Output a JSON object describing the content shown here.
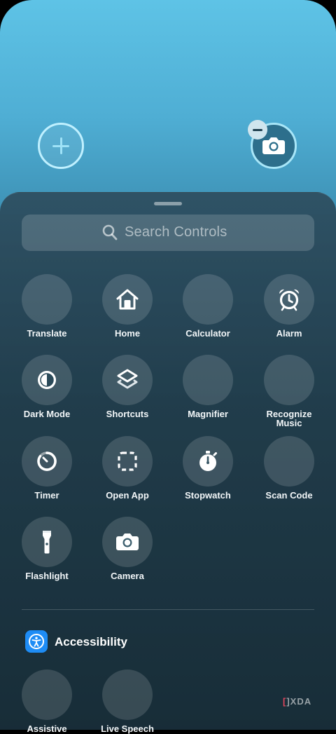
{
  "lock_screen": {
    "left_button_icon": "plus-icon",
    "right_button_icon": "camera-icon",
    "remove_badge_icon": "minus-icon"
  },
  "search": {
    "placeholder": "Search Controls",
    "icon": "magnifying-glass-icon"
  },
  "controls": [
    {
      "label": "Translate",
      "icon": "none"
    },
    {
      "label": "Home",
      "icon": "house-icon"
    },
    {
      "label": "Calculator",
      "icon": "none"
    },
    {
      "label": "Alarm",
      "icon": "alarm-clock-icon"
    },
    {
      "label": "Dark Mode",
      "icon": "half-circle-icon"
    },
    {
      "label": "Shortcuts",
      "icon": "stacked-layers-icon"
    },
    {
      "label": "Magnifier",
      "icon": "none"
    },
    {
      "label": "Recognize Music",
      "icon": "none"
    },
    {
      "label": "Timer",
      "icon": "timer-icon"
    },
    {
      "label": "Open App",
      "icon": "dashed-square-icon"
    },
    {
      "label": "Stopwatch",
      "icon": "stopwatch-icon"
    },
    {
      "label": "Scan Code",
      "icon": "none"
    },
    {
      "label": "Flashlight",
      "icon": "flashlight-icon"
    },
    {
      "label": "Camera",
      "icon": "camera-icon"
    }
  ],
  "accessibility": {
    "title": "Accessibility",
    "icon": "accessibility-icon",
    "controls": [
      {
        "label": "Assistive",
        "icon": "none"
      },
      {
        "label": "Live Speech",
        "icon": "none"
      }
    ]
  },
  "watermark": {
    "bracket": "[",
    "text": "]XDA"
  },
  "colors": {
    "accent": "#1e8cf5",
    "watermark_bracket": "#e0455c"
  }
}
